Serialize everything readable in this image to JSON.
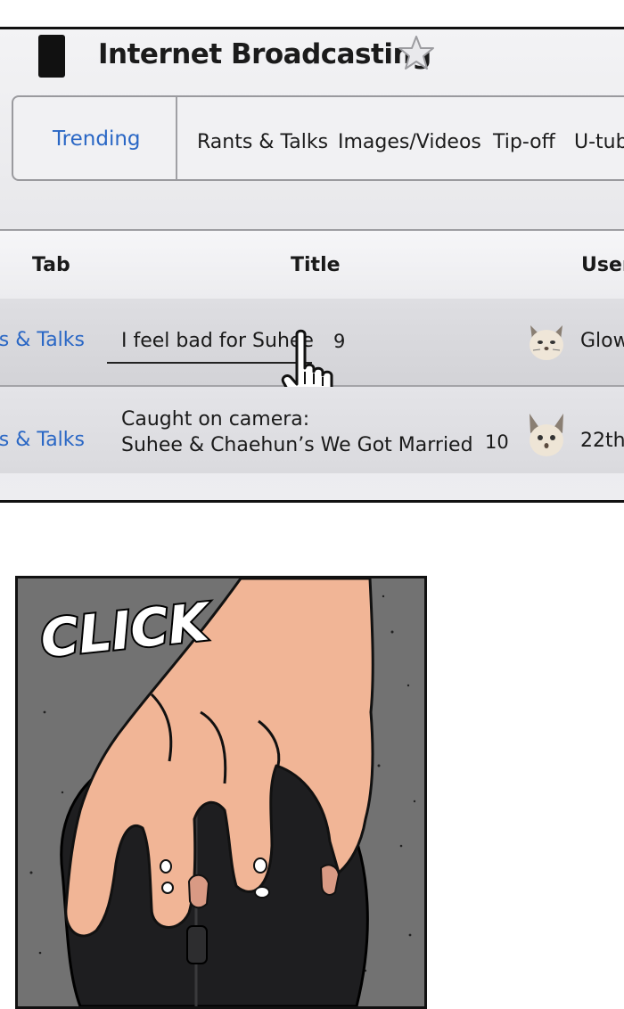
{
  "header": {
    "title": "Internet Broadcasting"
  },
  "tabs": {
    "active": "Trending",
    "items": [
      "Rants & Talks",
      "Images/Videos",
      "Tip-off",
      "U-tub"
    ]
  },
  "table": {
    "columns": [
      "Tab",
      "Title",
      "User"
    ],
    "rows": [
      {
        "tab": "Rants & Talks",
        "title_line1": "I feel bad for Suhee",
        "title_line2": "",
        "count": "9",
        "user": "Glow"
      },
      {
        "tab": "Rants & Talks",
        "title_line1": "Caught on camera:",
        "title_line2": "Suhee & Chaehun’s We Got Married",
        "count": "10",
        "user": "22th"
      }
    ]
  },
  "panel": {
    "sfx": "CLICK"
  },
  "colors": {
    "link_blue": "#2a67c5",
    "frame": "#111111",
    "skin": "#f1b596",
    "mouse": "#1e1e20"
  },
  "icons": [
    "star-icon",
    "cursor-hand-icon",
    "cat-avatar-icon"
  ]
}
